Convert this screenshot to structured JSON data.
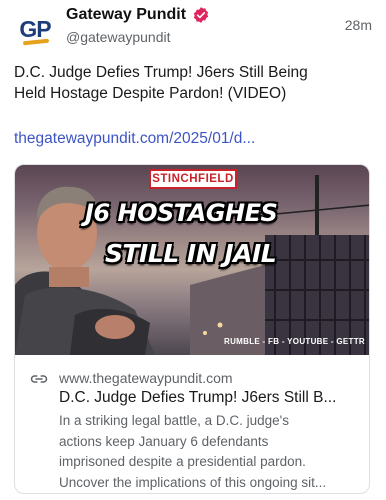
{
  "author": {
    "avatar_text": "GP",
    "display_name": "Gateway Pundit",
    "handle": "@gatewaypundit",
    "verified_icon": "verified-badge-icon"
  },
  "post": {
    "timestamp": "28m",
    "text_line_1": "D.C. Judge Defies Trump! J6ers Still Being",
    "text_line_2": "Held Hostage Despite Pardon! (VIDEO)",
    "link": "thegatewaypundit.com/2025/01/d..."
  },
  "card": {
    "image": {
      "brand": "STINCHFIELD",
      "headline_1": "J6 HOSTAGHES",
      "headline_2": "STILL IN JAIL",
      "platforms": "RUMBLE - FB - YOUTUBE - GETTR"
    },
    "link_icon": "link-icon",
    "domain": "www.thegatewaypundit.com",
    "title": "D.C. Judge Defies Trump! J6ers Still B...",
    "description_lines": [
      "In a striking legal battle, a D.C. judge's",
      "actions keep January 6 defendants",
      "imprisoned despite a presidential pardon.",
      "Uncover the implications of this ongoing sit..."
    ]
  },
  "colors": {
    "link": "#3d55c4",
    "verified": "#e0245e",
    "brand_red": "#c9222a",
    "avatar_blue": "#1d3d7a",
    "avatar_accent": "#e6a11d"
  }
}
